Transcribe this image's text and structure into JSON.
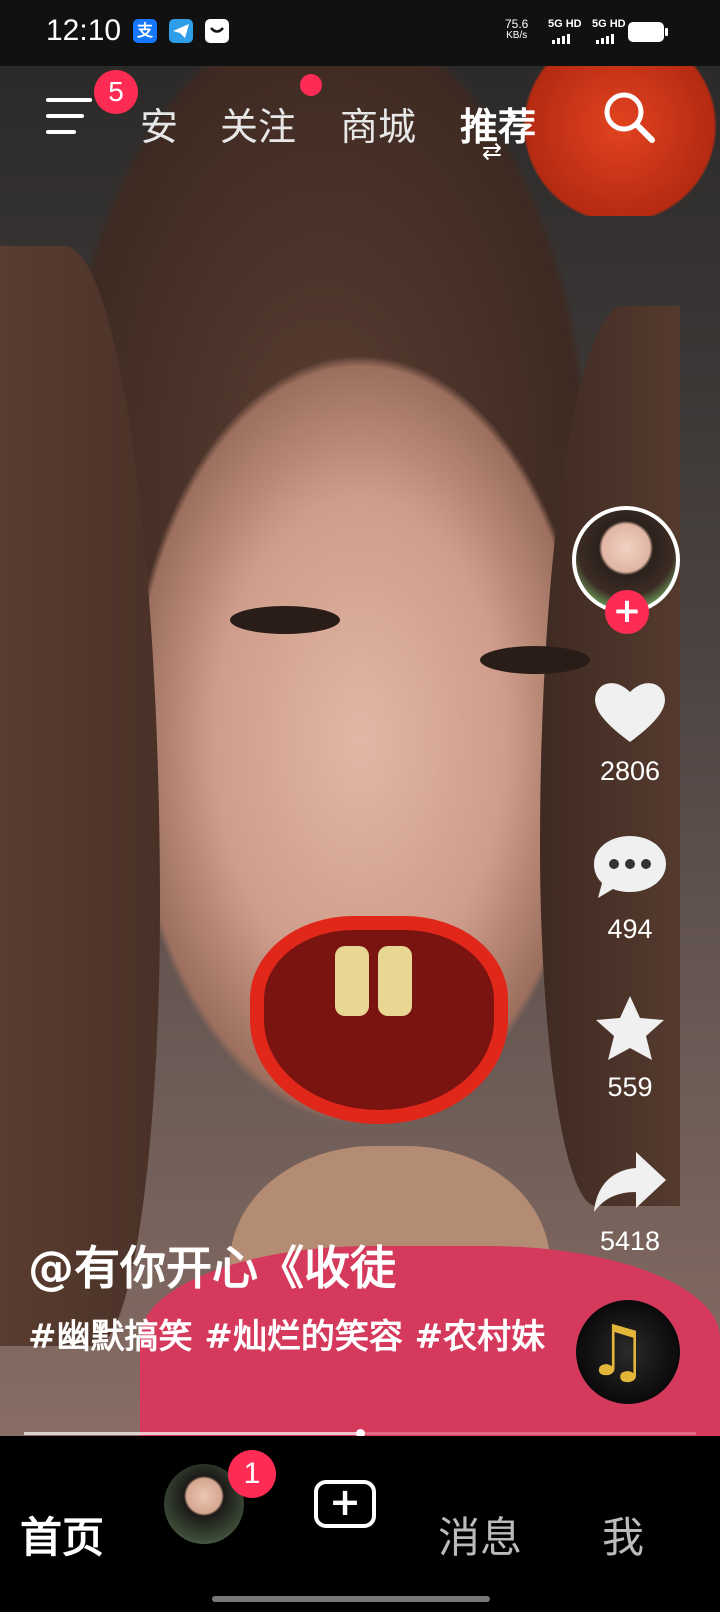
{
  "status_bar": {
    "time": "12:10",
    "net_speed": "75.6",
    "net_unit": "KB/s",
    "signal1": "5G HD",
    "signal2": "5G HD"
  },
  "top_nav": {
    "menu_badge": "5",
    "tabs": [
      {
        "label": "安"
      },
      {
        "label": "关注"
      },
      {
        "label": "商城"
      },
      {
        "label": "推荐"
      }
    ],
    "active_tab": "推荐"
  },
  "video": {
    "author": "@有你开心《收徒",
    "description": "#幽默搞笑 #灿烂的笑容 #农村妹",
    "progress": 0.5
  },
  "rail": {
    "likes": "2806",
    "comments": "494",
    "favorites": "559",
    "shares": "5418",
    "follow_symbol": "+"
  },
  "bottom_nav": {
    "home": "首页",
    "badge": "1",
    "create_symbol": "+",
    "messages": "消息",
    "me": "我"
  },
  "colors": {
    "accent": "#fe2c55",
    "background": "#000000"
  }
}
